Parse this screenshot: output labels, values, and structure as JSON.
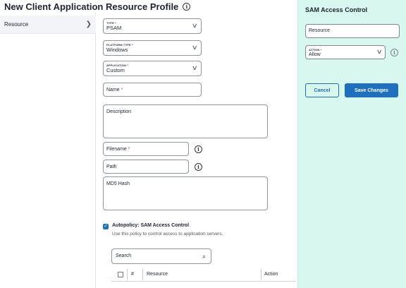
{
  "page": {
    "title": "New Client Application Resource Profile"
  },
  "sidebar": {
    "items": [
      {
        "label": "Resource"
      }
    ]
  },
  "form": {
    "type": {
      "label": "TYPE *",
      "value": "PSAM"
    },
    "platform_type": {
      "label": "PLATFORM TYPE *",
      "value": "Windows"
    },
    "application": {
      "label": "APPLICATION *",
      "value": "Custom"
    },
    "name": {
      "label": "Name",
      "required_mark": "*"
    },
    "description": {
      "label": "Description"
    },
    "filename": {
      "label": "Filename",
      "required_mark": "*"
    },
    "path": {
      "label": "Path"
    },
    "md5": {
      "label": "MD5 Hash"
    }
  },
  "autopolicy": {
    "checked": true,
    "label": "Autopolicy: SAM Access Control",
    "description": "Use this policy to control access to application servers."
  },
  "search": {
    "label": "Search"
  },
  "table": {
    "columns": [
      "#",
      "Resource",
      "Action"
    ]
  },
  "panel": {
    "title": "SAM Access Control",
    "resource_field": {
      "label": "Resource"
    },
    "action": {
      "label": "ACTION *",
      "value": "Allow"
    },
    "cancel_label": "Cancel",
    "save_label": "Save Changes"
  },
  "colors": {
    "accent": "#1f6fbf",
    "panel_bg": "#d8f7ee",
    "required": "#d23b3b"
  },
  "icons": {
    "info": "info-icon",
    "chevron": "chevron-down-icon",
    "search": "search-icon",
    "check": "check-icon",
    "sidebar_arrow": "chevron-right-icon"
  }
}
